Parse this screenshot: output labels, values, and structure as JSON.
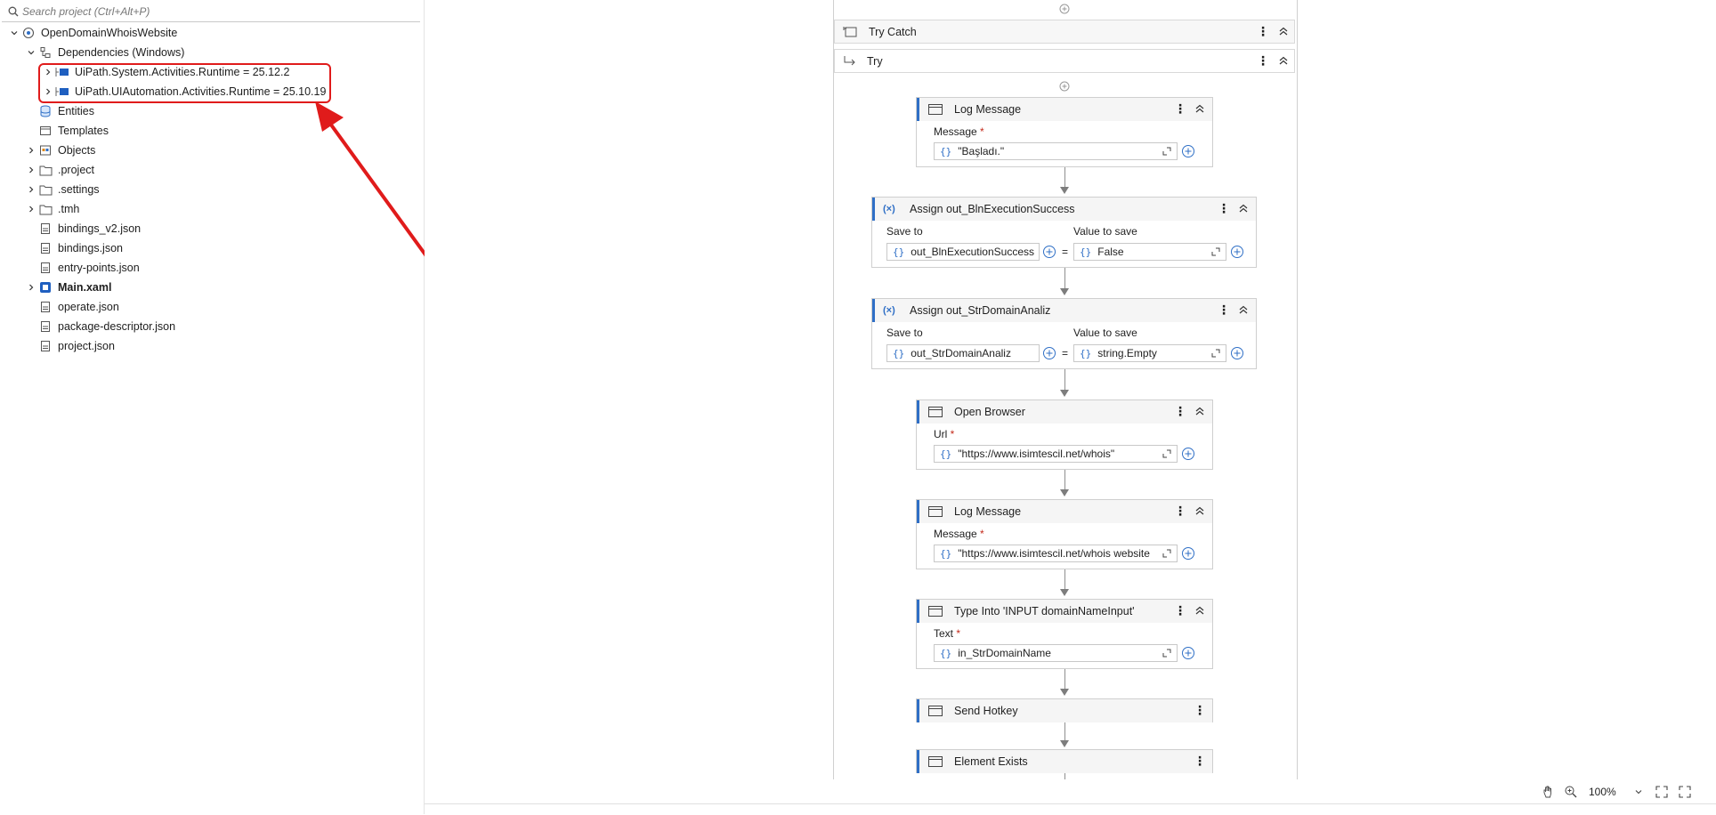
{
  "search": {
    "placeholder": "Search project (Ctrl+Alt+P)"
  },
  "tree": {
    "project_name": "OpenDomainWhoisWebsite",
    "dependencies_label": "Dependencies (Windows)",
    "dep_system": "UiPath.System.Activities.Runtime = 25.12.2",
    "dep_uiautomation": "UiPath.UIAutomation.Activities.Runtime = 25.10.19",
    "entities": "Entities",
    "templates": "Templates",
    "objects": "Objects",
    "project_folder": ".project",
    "settings_folder": ".settings",
    "tmh_folder": ".tmh",
    "bindings_v2": "bindings_v2.json",
    "bindings": "bindings.json",
    "entry_points": "entry-points.json",
    "main_xaml": "Main.xaml",
    "operate": "operate.json",
    "package_descriptor": "package-descriptor.json",
    "project_json": "project.json"
  },
  "workflow": {
    "try_catch": "Try Catch",
    "try": "Try",
    "log1": {
      "title": "Log Message",
      "label": "Message",
      "value": "\"Başladı.\""
    },
    "assign1": {
      "title": "Assign out_BlnExecutionSuccess",
      "save_label": "Save to",
      "value_label": "Value to save",
      "save_to": "out_BlnExecutionSuccess",
      "value": "False"
    },
    "assign2": {
      "title": "Assign out_StrDomainAnaliz",
      "save_label": "Save to",
      "value_label": "Value to save",
      "save_to": "out_StrDomainAnaliz",
      "value": "string.Empty"
    },
    "open_browser": {
      "title": "Open Browser",
      "label": "Url",
      "value": "\"https://www.isimtescil.net/whois\""
    },
    "log2": {
      "title": "Log Message",
      "label": "Message",
      "value": "\"https://www.isimtescil.net/whois website"
    },
    "type_into": {
      "title": "Type Into 'INPUT  domainNameInput'",
      "label": "Text",
      "value": "in_StrDomainName"
    },
    "send_hotkey": {
      "title": "Send Hotkey"
    },
    "element_exists": {
      "title": "Element Exists"
    },
    "equals_sign": "=",
    "required_mark": "*"
  },
  "toolbar": {
    "zoom": "100%"
  },
  "colors": {
    "accent": "#2f6fc6",
    "highlight": "#e01b1b"
  }
}
